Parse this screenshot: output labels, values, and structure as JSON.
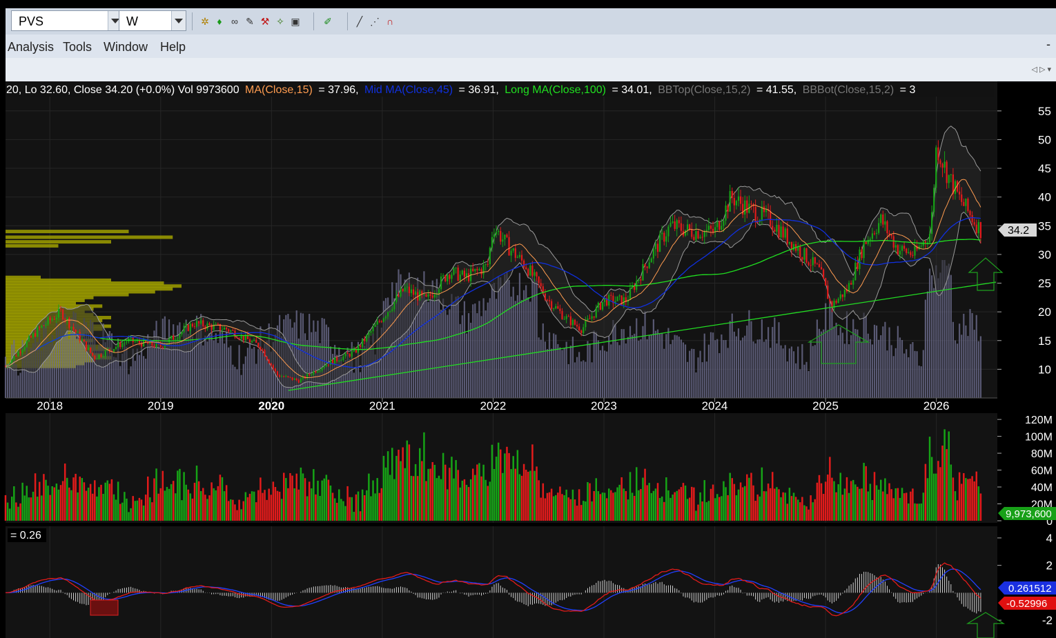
{
  "toolbar": {
    "symbol": "PVS",
    "interval": "W",
    "icons": [
      "indicator-icon",
      "signal-icon",
      "zoom-icon",
      "draw-icon",
      "analysis-icon",
      "wand-icon",
      "chart-icon",
      "pen-icon",
      "line-icon",
      "ray-icon",
      "magnet-icon"
    ]
  },
  "menu": {
    "analysis": "Analysis",
    "tools": "Tools",
    "window": "Window",
    "help": "Help",
    "minimize": "-"
  },
  "header": {
    "prefix": "20, Lo 32.60, Close 34.20 (+0.0%) Vol 9973600",
    "ma15_label": "MA(Close,15)",
    "ma15_value": "= 37.96,",
    "ma45_label": "Mid MA(Close,45)",
    "ma45_value": "= 36.91,",
    "ma100_label": "Long MA(Close,100)",
    "ma100_value": "= 34.01,",
    "bbtop_label": "BBTop(Close,15,2)",
    "bbtop_value": "= 41.55,",
    "bbbot_label": "BBBot(Close,15,2)",
    "bbbot_value": "= 3"
  },
  "colors": {
    "bg": "#121212",
    "up": "#16a316",
    "down": "#e21b1b",
    "ma15": "#ff9c50",
    "ma45": "#1030e0",
    "ma100": "#20e020",
    "bb": "#9a9a9a",
    "vol_overlay": "#6c6c8c",
    "profile": "#a0a000",
    "macd": "#e21b1b",
    "signal": "#2240ff",
    "hist": "#cfcfcf"
  },
  "chart_data": [
    {
      "type": "line",
      "title": "",
      "x_ticks": [
        "2018",
        "2019",
        "2020",
        "2021",
        "2022",
        "2023",
        "2024",
        "2025",
        "2026"
      ],
      "x_range": [
        2017.6,
        2026.55
      ],
      "y_ticks": [
        10,
        15,
        20,
        25,
        30,
        35,
        40,
        45,
        50,
        55
      ],
      "y_range": [
        5,
        57.5
      ],
      "last_price_label": "34.2",
      "series": [
        {
          "name": "Close",
          "x": [
            2017.6,
            2017.9,
            2018.1,
            2018.4,
            2018.7,
            2019.0,
            2019.3,
            2019.6,
            2019.9,
            2020.05,
            2020.25,
            2020.5,
            2020.75,
            2021.0,
            2021.2,
            2021.4,
            2021.6,
            2021.75,
            2021.95,
            2022.0,
            2022.15,
            2022.3,
            2022.5,
            2022.65,
            2022.8,
            2023.0,
            2023.2,
            2023.4,
            2023.6,
            2023.8,
            2024.0,
            2024.15,
            2024.3,
            2024.5,
            2024.65,
            2024.8,
            2024.95,
            2025.05,
            2025.2,
            2025.35,
            2025.5,
            2025.65,
            2025.8,
            2025.95,
            2026.0,
            2026.1,
            2026.2,
            2026.3,
            2026.4
          ],
          "y": [
            10.5,
            17,
            20,
            12,
            15,
            14,
            18,
            17,
            14,
            9,
            8,
            11,
            13,
            19,
            24,
            22,
            27,
            26,
            28,
            35,
            31,
            28,
            22,
            19,
            17,
            22,
            22,
            29,
            35,
            34,
            34,
            40,
            38,
            36,
            33,
            30,
            27,
            21,
            24,
            32,
            36,
            31,
            30,
            34,
            49,
            44,
            40,
            37,
            34.2
          ]
        }
      ]
    },
    {
      "type": "bar",
      "title": "",
      "y_ticks": [
        "0",
        "20M",
        "40M",
        "60M",
        "80M",
        "100M",
        "120M"
      ],
      "y_range": [
        0,
        125
      ],
      "last_value_label": "9,973,600"
    },
    {
      "type": "line",
      "title": "",
      "header": "= 0.26",
      "y_ticks": [
        -2,
        2,
        4
      ],
      "y_range": [
        -3.3,
        4.7
      ],
      "macd_label": "0.261512",
      "signal_label": "-0.52996"
    }
  ]
}
